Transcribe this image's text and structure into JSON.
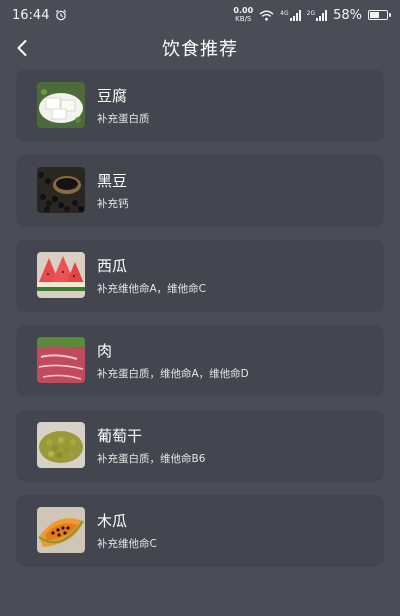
{
  "status_bar": {
    "time": "16:44",
    "net_speed_value": "0.00",
    "net_speed_unit": "KB/S",
    "network_label_1": "4G",
    "network_label_2": "2G",
    "battery_percent": "58%",
    "battery_level": 0.58
  },
  "header": {
    "title": "饮食推荐"
  },
  "foods": [
    {
      "name": "豆腐",
      "desc": "补充蛋白质",
      "icon": "tofu-image"
    },
    {
      "name": "黑豆",
      "desc": "补充钙",
      "icon": "black-beans-image"
    },
    {
      "name": "西瓜",
      "desc": "补充维他命A，维他命C",
      "icon": "watermelon-image"
    },
    {
      "name": "肉",
      "desc": "补充蛋白质，维他命A，维他命D",
      "icon": "meat-image"
    },
    {
      "name": "葡萄干",
      "desc": "补充蛋白质，维他命B6",
      "icon": "raisins-image"
    },
    {
      "name": "木瓜",
      "desc": "补充维他命C",
      "icon": "papaya-image"
    }
  ]
}
